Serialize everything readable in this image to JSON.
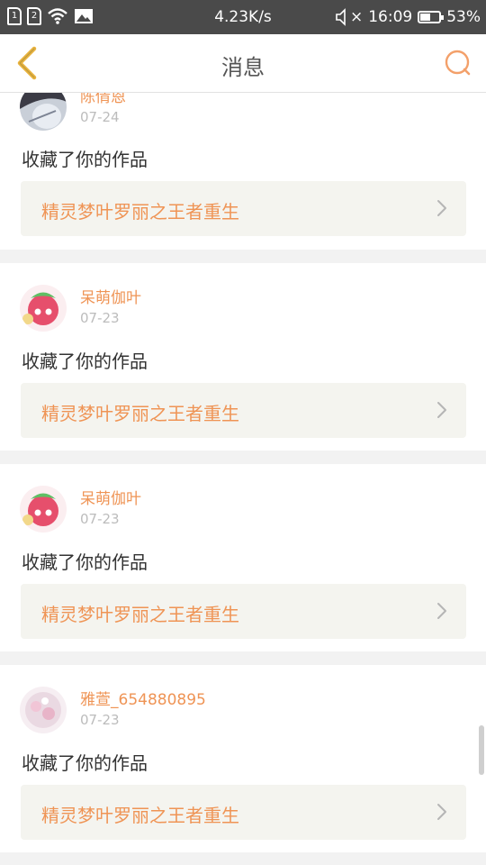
{
  "status_bar": {
    "sim1": "1",
    "sim2": "2",
    "net_speed": "4.23K/s",
    "mute_symbol": "×",
    "time": "16:09",
    "battery": "53%",
    "battery_level": 0.53
  },
  "header": {
    "title": "消息",
    "back_icon": "chevron-left-icon",
    "search_icon": "search-icon",
    "accent": "#e9b33e",
    "search_color": "#f3a06a"
  },
  "messages": [
    {
      "user": "陈倩恩",
      "date": "07-24",
      "action": "收藏了你的作品",
      "work": "精灵梦叶罗丽之王者重生"
    },
    {
      "user": "呆萌伽叶",
      "date": "07-23",
      "action": "收藏了你的作品",
      "work": "精灵梦叶罗丽之王者重生"
    },
    {
      "user": "呆萌伽叶",
      "date": "07-23",
      "action": "收藏了你的作品",
      "work": "精灵梦叶罗丽之王者重生"
    },
    {
      "user": "雅萱_654880895",
      "date": "07-23",
      "action": "收藏了你的作品",
      "work": "精灵梦叶罗丽之王者重生"
    }
  ],
  "colors": {
    "username": "#ef9455",
    "date": "#bcbcbc",
    "link_bg": "#f4f4ef"
  }
}
